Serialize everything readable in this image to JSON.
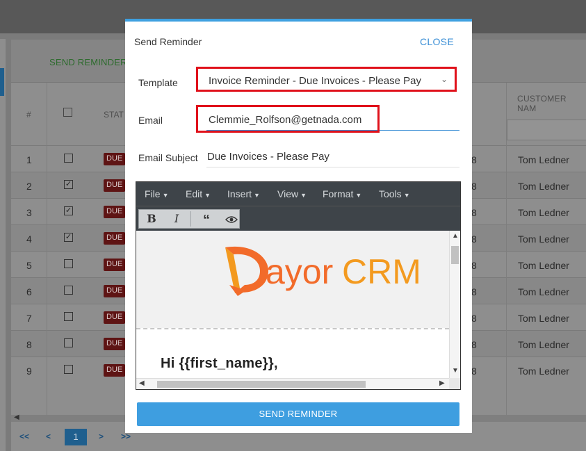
{
  "background": {
    "send_reminder_link": "SEND REMINDER",
    "columns": {
      "hash": "#",
      "status": "STAT",
      "customer": "CUSTOMER NAM"
    },
    "rows": [
      {
        "num": "1",
        "checked": false,
        "status": "DUE",
        "col8": "8",
        "customer": "Tom Ledner"
      },
      {
        "num": "2",
        "checked": true,
        "status": "DUE",
        "col8": "8",
        "customer": "Tom Ledner"
      },
      {
        "num": "3",
        "checked": true,
        "status": "DUE",
        "col8": "8",
        "customer": "Tom Ledner"
      },
      {
        "num": "4",
        "checked": true,
        "status": "DUE",
        "col8": "8",
        "customer": "Tom Ledner"
      },
      {
        "num": "5",
        "checked": false,
        "status": "DUE",
        "col8": "8",
        "customer": "Tom Ledner"
      },
      {
        "num": "6",
        "checked": false,
        "status": "DUE",
        "col8": "8",
        "customer": "Tom Ledner"
      },
      {
        "num": "7",
        "checked": false,
        "status": "DUE",
        "col8": "8",
        "customer": "Tom Ledner"
      },
      {
        "num": "8",
        "checked": false,
        "status": "DUE",
        "col8": "8",
        "customer": "Tom Ledner"
      },
      {
        "num": "9",
        "checked": false,
        "status": "DUE",
        "col8": "8",
        "customer": "Tom Ledner"
      }
    ],
    "pager": {
      "first": "<<",
      "prev": "<",
      "current": "1",
      "next": ">",
      "last": ">>"
    }
  },
  "modal": {
    "title": "Send Reminder",
    "close_label": "CLOSE",
    "template": {
      "label": "Template",
      "value": "Invoice Reminder - Due Invoices - Please Pay"
    },
    "email": {
      "label": "Email",
      "value": "Clemmie_Rolfson@getnada.com"
    },
    "subject": {
      "label": "Email Subject",
      "value": "Due Invoices - Please Pay"
    },
    "editor": {
      "menu": [
        "File",
        "Edit",
        "Insert",
        "View",
        "Format",
        "Tools"
      ],
      "toolbar": {
        "bold": "B",
        "italic": "I",
        "quote": "“",
        "preview_icon": "eye-icon"
      },
      "logo_text_1": "ayor",
      "logo_text_2": "CRM",
      "greeting": "Hi {{first_name}},"
    },
    "send_button": "SEND REMINDER"
  },
  "colors": {
    "accent": "#3e9ee0",
    "highlight": "#e0111b",
    "logo_orange": "#f26b2a",
    "logo_amber": "#f39a1f"
  }
}
